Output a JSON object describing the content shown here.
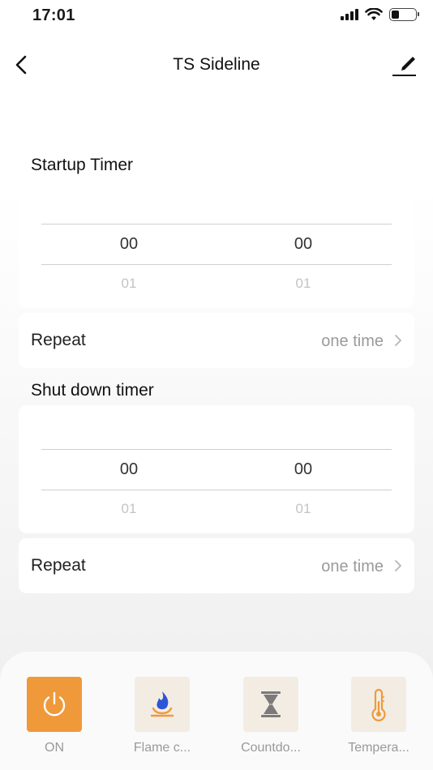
{
  "status_bar": {
    "time": "17:01"
  },
  "nav": {
    "title": "TS Sideline"
  },
  "startup": {
    "title": "Startup Timer",
    "hour": "00",
    "minute": "00",
    "hour_next": "01",
    "minute_next": "01",
    "repeat_label": "Repeat",
    "repeat_value": "one time"
  },
  "shutdown": {
    "title": "Shut down timer",
    "hour": "00",
    "minute": "00",
    "hour_next": "01",
    "minute_next": "01",
    "repeat_label": "Repeat",
    "repeat_value": "one time"
  },
  "tabs": [
    {
      "label": "ON",
      "icon": "power-icon",
      "active": true
    },
    {
      "label": "Flame c...",
      "icon": "flame-icon",
      "active": false
    },
    {
      "label": "Countdo...",
      "icon": "hourglass-icon",
      "active": false
    },
    {
      "label": "Tempera...",
      "icon": "thermometer-icon",
      "active": false
    }
  ],
  "colors": {
    "accent": "#f0993a",
    "flame": "#2e55d6",
    "icon_tint": "#f0993a",
    "hourglass": "#7a7a7a"
  }
}
